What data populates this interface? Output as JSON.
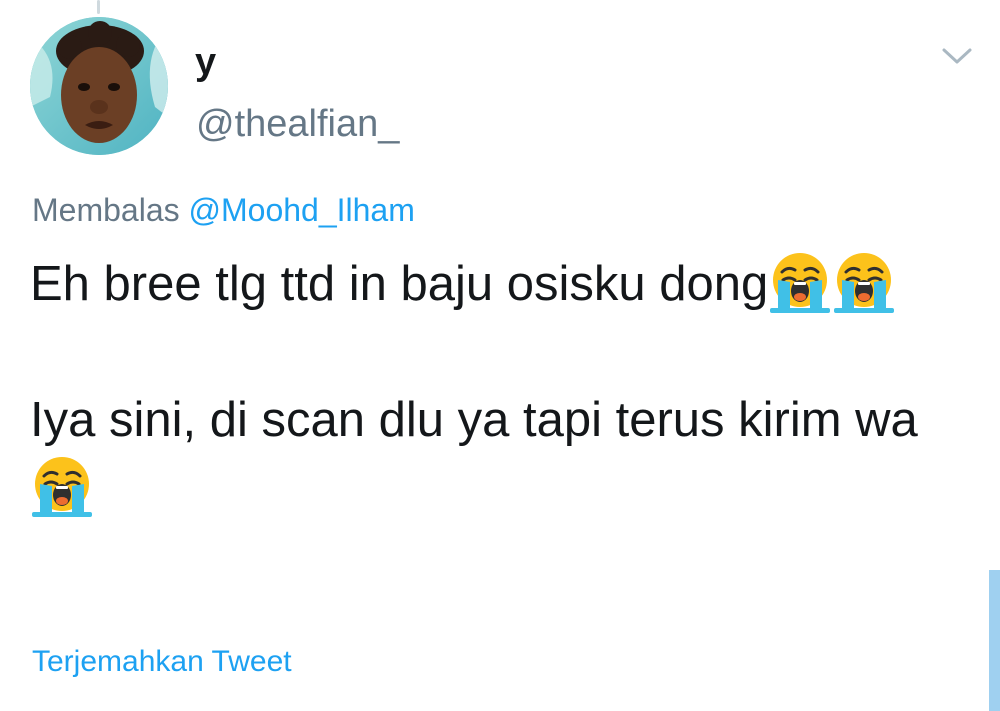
{
  "tweet": {
    "display_name": "y",
    "handle": "@thealfian_",
    "reply_prefix": "Membalas ",
    "reply_mention": "@Moohd_Ilham",
    "text_line_1": "Eh bree tlg ttd in baju osisku dong",
    "text_line_2": "Iya sini, di scan dlu ya tapi terus kirim wa",
    "translate_label": "Terjemahkan Tweet"
  },
  "icons": {
    "menu": "chevron-down-icon",
    "emoji": "loudly-crying-face"
  },
  "colors": {
    "link": "#1da1f2",
    "secondary_text": "#657786",
    "primary_text": "#14171a"
  }
}
